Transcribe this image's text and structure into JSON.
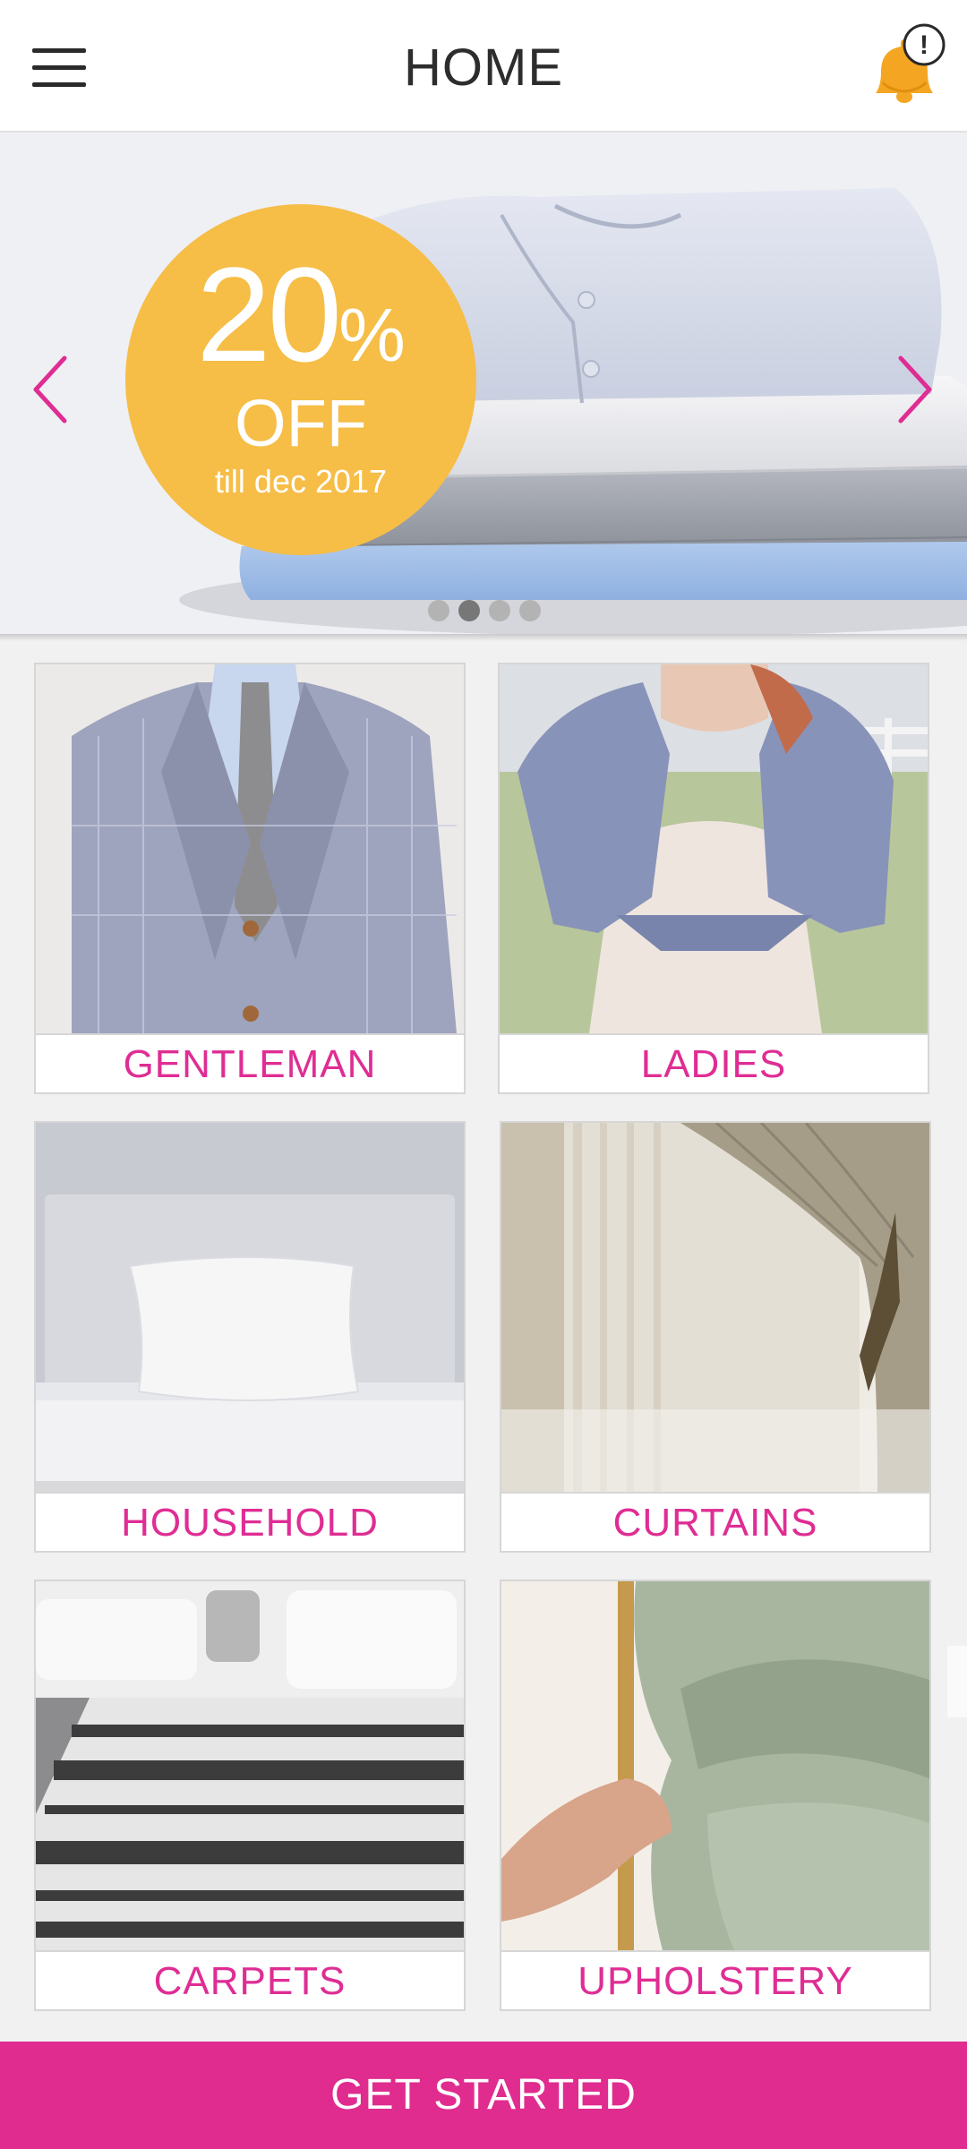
{
  "header": {
    "title": "HOME",
    "menu_icon": "hamburger-menu-icon",
    "notification_icon": "bell-alert-icon",
    "notification_badge": "!"
  },
  "banner": {
    "promo_value": "20",
    "promo_symbol": "%",
    "promo_off": "OFF",
    "promo_until": "till dec 2017",
    "slide_count": 4,
    "active_slide": 2,
    "accent_color": "#e02b8f",
    "promo_color": "#f6bd47"
  },
  "categories": [
    {
      "label": "GENTLEMAN"
    },
    {
      "label": "LADIES"
    },
    {
      "label": "HOUSEHOLD"
    },
    {
      "label": "CURTAINS"
    },
    {
      "label": "CARPETS"
    },
    {
      "label": "UPHOLSTERY"
    }
  ],
  "footer": {
    "cta_label": "GET STARTED"
  }
}
